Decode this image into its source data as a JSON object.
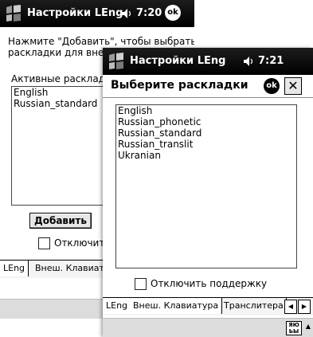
{
  "background_window": {
    "title": "Настройки LEng",
    "time": "7:20",
    "ok_label": "ok",
    "instruction_line1": "Нажмите \"Добавить\", чтобы выбрать",
    "instruction_line2": "раскладки для вне",
    "active_label": "Активные расклад",
    "active_layouts": [
      "English",
      "Russian_standard"
    ],
    "add_button": "Добавить",
    "disable_checkbox_label": "Отключит",
    "tabs": [
      "LEng",
      "Внеш. Клавиат"
    ]
  },
  "dialog_window": {
    "title": "Настройки LEng",
    "time": "7:21",
    "dialog_title": "Выберите раскладки",
    "ok_label": "ok",
    "close_label": "✕",
    "layouts": [
      "English",
      "Russian_phonetic",
      "Russian_standard",
      "Russian_translit",
      "Ukranian"
    ],
    "disable_checkbox_label": "Отключить поддержку",
    "tabs": [
      "LEng",
      "Внеш. Клавиатура",
      "Транслитера"
    ],
    "tab_scroll_left": "◀",
    "tab_scroll_right": "▶",
    "sip_label_top": "ЯЮ",
    "sip_label_bottom": "ЬЫ",
    "sip_arrow": "▲"
  }
}
